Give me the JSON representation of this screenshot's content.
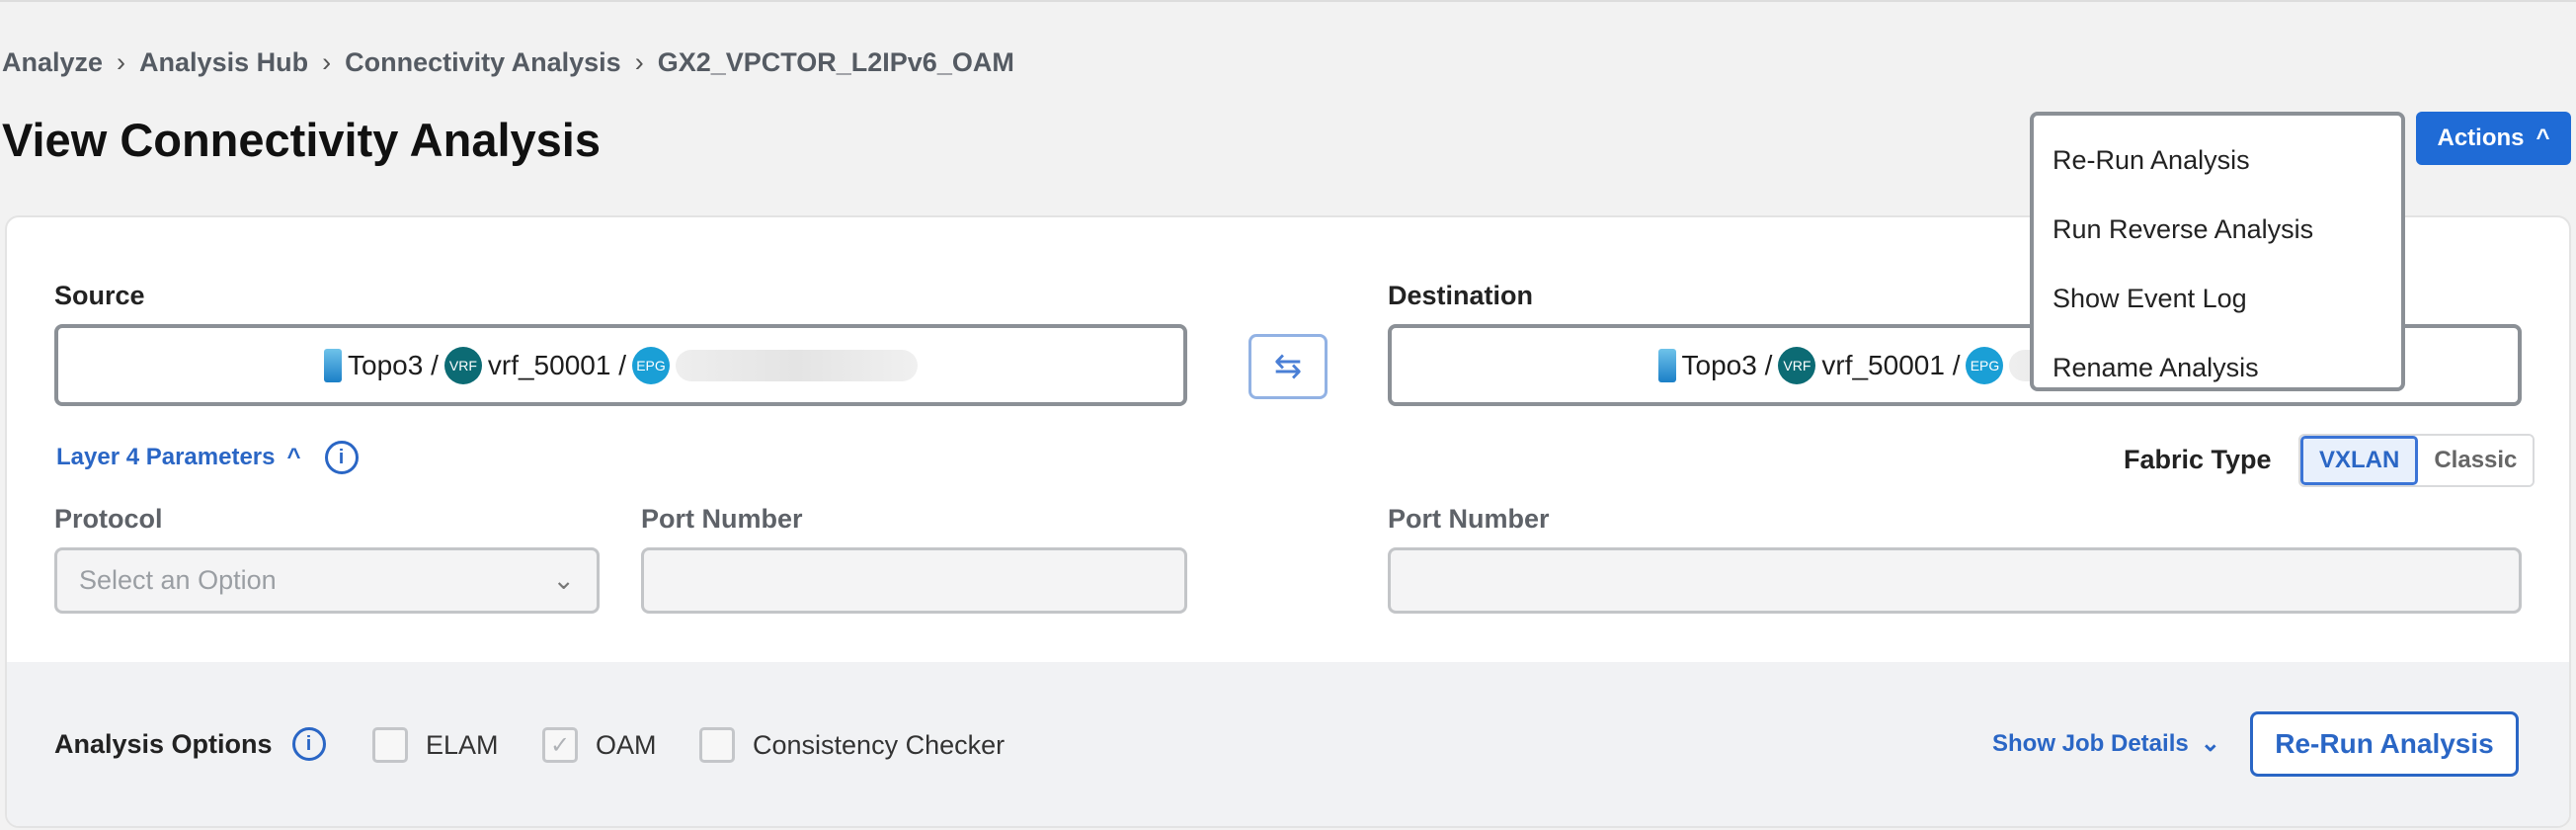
{
  "breadcrumb": [
    "Analyze",
    "Analysis Hub",
    "Connectivity Analysis",
    "GX2_VPCTOR_L2IPv6_OAM"
  ],
  "title": "View Connectivity Analysis",
  "actions": {
    "label": "Actions",
    "menu": [
      "Re-Run Analysis",
      "Run Reverse Analysis",
      "Show Event Log",
      "Rename Analysis"
    ]
  },
  "source": {
    "label": "Source",
    "fabric": "Topo3 /",
    "vrf_badge": "VRF",
    "vrf": "vrf_50001 /",
    "epg_badge": "EPG"
  },
  "destination": {
    "label": "Destination",
    "fabric": "Topo3 /",
    "vrf_badge": "VRF",
    "vrf": "vrf_50001 /",
    "epg_badge": "EPG"
  },
  "layer4": {
    "label": "Layer 4 Parameters",
    "protocol_label": "Protocol",
    "protocol_placeholder": "Select an Option",
    "port_label": "Port Number",
    "dest_port_label": "Port Number"
  },
  "fabric_type": {
    "label": "Fabric Type",
    "options": [
      "VXLAN",
      "Classic"
    ],
    "selected": "VXLAN"
  },
  "analysis_options": {
    "label": "Analysis Options",
    "options": [
      {
        "label": "ELAM",
        "checked": false
      },
      {
        "label": "OAM",
        "checked": true,
        "disabled": true
      },
      {
        "label": "Consistency Checker",
        "checked": false
      }
    ]
  },
  "show_job_details": "Show Job Details",
  "rerun_button": "Re-Run Analysis",
  "colors": {
    "accent": "#1f6bd6",
    "vrf": "#0c6b74",
    "epg": "#1a9fd6"
  }
}
